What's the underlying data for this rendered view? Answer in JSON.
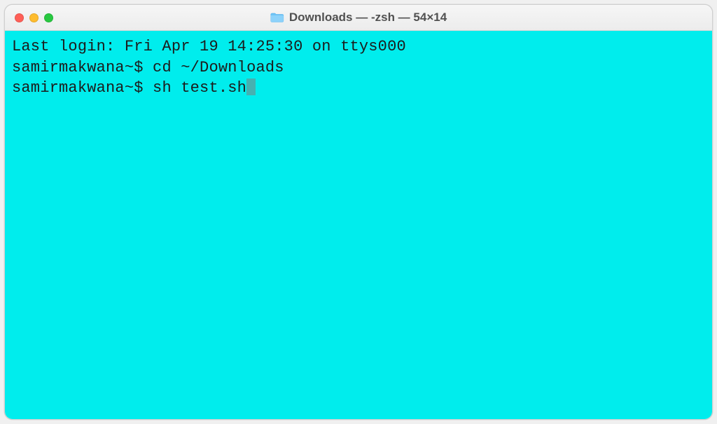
{
  "titlebar": {
    "title": "Downloads — -zsh — 54×14"
  },
  "terminal": {
    "last_login": "Last login: Fri Apr 19 14:25:30 on ttys000",
    "lines": [
      {
        "prompt": "samirmakwana~$ ",
        "command": "cd ~/Downloads"
      },
      {
        "prompt": "samirmakwana~$ ",
        "command": "sh test.sh"
      }
    ]
  }
}
